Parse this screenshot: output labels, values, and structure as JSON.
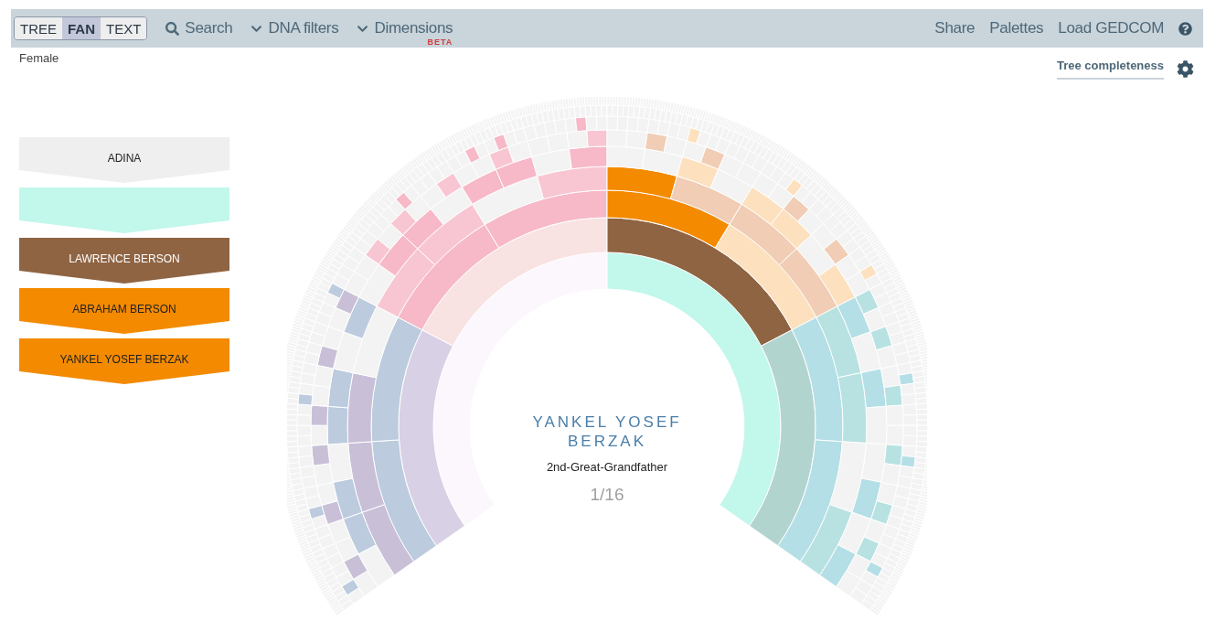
{
  "toolbar": {
    "views": [
      {
        "label": "TREE",
        "selected": false
      },
      {
        "label": "FAN",
        "selected": true
      },
      {
        "label": "TEXT",
        "selected": false
      }
    ],
    "menus": [
      {
        "kind": "search",
        "label": "Search"
      },
      {
        "kind": "dropdown",
        "label": "DNA filters"
      },
      {
        "kind": "dropdown",
        "label": "Dimensions",
        "badge": "BETA"
      }
    ],
    "links": [
      "Share",
      "Palettes",
      "Load GEDCOM"
    ]
  },
  "gender": "Female",
  "completeness": {
    "label": "Tree completeness"
  },
  "lineage": [
    {
      "name": "ADINA",
      "color": "#efefef"
    },
    {
      "color": "#c2f7ec"
    },
    {
      "name": "LAWRENCE BERSON",
      "color": "#8f6443"
    },
    {
      "name": "ABRAHAM BERSON",
      "color": "#f38a00"
    },
    {
      "name": "YANKEL YOSEF BERZAK",
      "color": "#f38a00"
    }
  ],
  "focus": {
    "name": "YANKEL YOSEF BERZAK",
    "relation": "2nd-Great-Grandfather",
    "count": "1/16"
  }
}
